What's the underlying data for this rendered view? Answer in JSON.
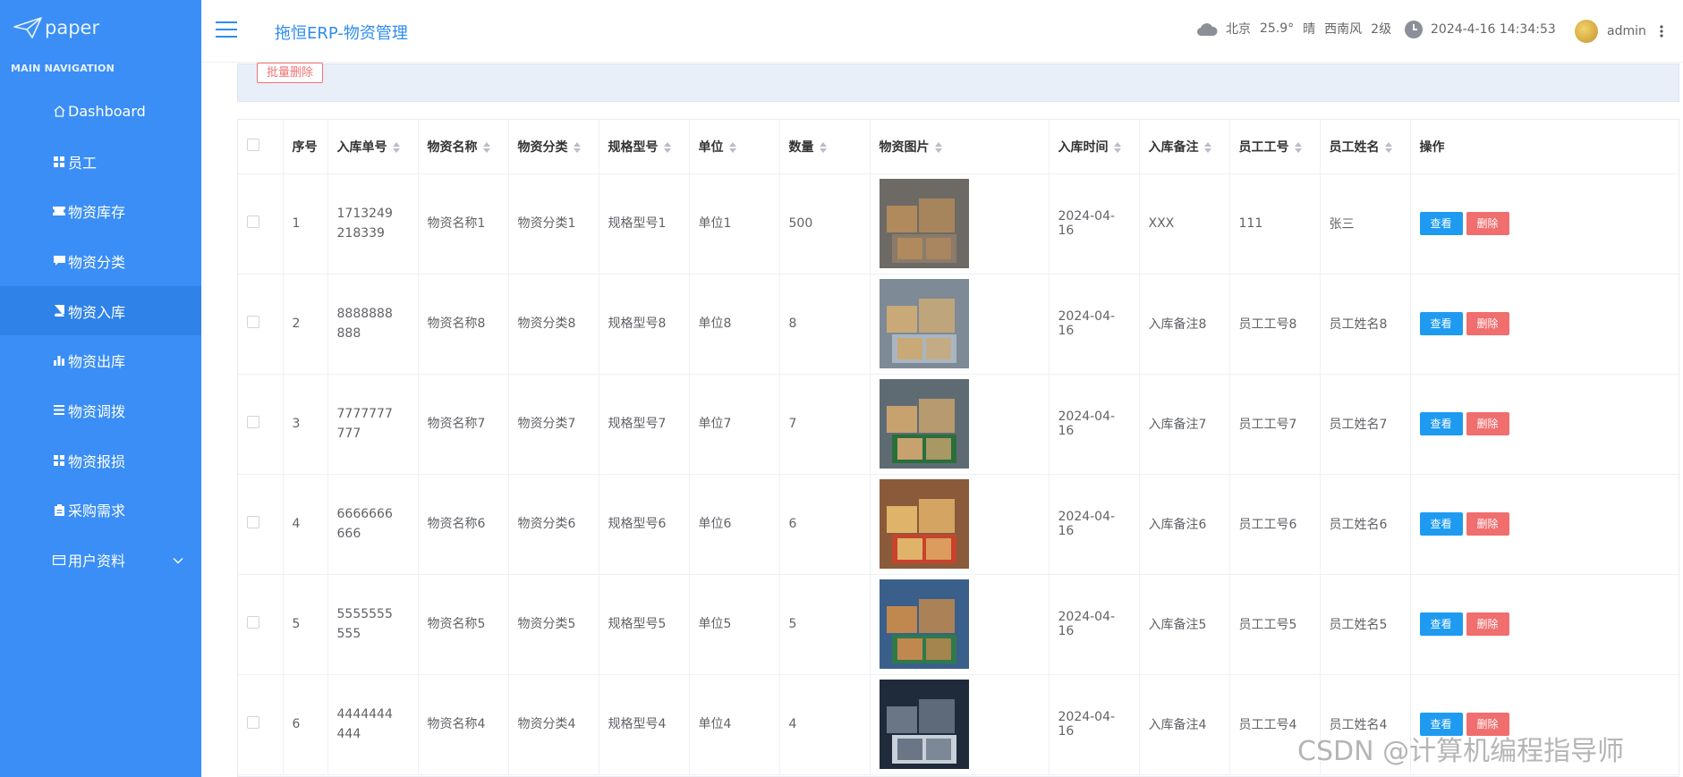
{
  "brand": {
    "name": "paper"
  },
  "sidebar": {
    "heading": "MAIN NAVIGATION",
    "items": [
      {
        "label": "Dashboard",
        "icon": "home-icon"
      },
      {
        "label": "员工",
        "icon": "grid-icon"
      },
      {
        "label": "物资库存",
        "icon": "ticket-icon"
      },
      {
        "label": "物资分类",
        "icon": "comment-icon"
      },
      {
        "label": "物资入库",
        "icon": "book-icon",
        "active": true
      },
      {
        "label": "物资出库",
        "icon": "bar-chart-icon"
      },
      {
        "label": "物资调拨",
        "icon": "list-icon"
      },
      {
        "label": "物资报损",
        "icon": "grid-icon"
      },
      {
        "label": "采购需求",
        "icon": "clipboard-icon"
      },
      {
        "label": "用户资料",
        "icon": "card-icon",
        "expandable": true
      }
    ]
  },
  "header": {
    "title": "拖恒ERP-物资管理",
    "weather": {
      "city": "北京",
      "temp": "25.9°",
      "condition": "晴",
      "wind": "西南风",
      "level": "2级"
    },
    "datetime": "2024-4-16 14:34:53",
    "user": "admin"
  },
  "toolbar": {
    "batch_delete": "批量删除"
  },
  "table": {
    "columns": [
      "序号",
      "入库单号",
      "物资名称",
      "物资分类",
      "规格型号",
      "单位",
      "数量",
      "物资图片",
      "入库时间",
      "入库备注",
      "员工工号",
      "员工姓名",
      "操作"
    ],
    "rows": [
      {
        "no": "1",
        "order": "1713249218339",
        "name": "物资名称1",
        "category": "物资分类1",
        "spec": "规格型号1",
        "unit": "单位1",
        "qty": "500",
        "time": "2024-04-16",
        "note": "XXX",
        "emp_id": "111",
        "emp_name": "张三"
      },
      {
        "no": "2",
        "order": "8888888888",
        "name": "物资名称8",
        "category": "物资分类8",
        "spec": "规格型号8",
        "unit": "单位8",
        "qty": "8",
        "time": "2024-04-16",
        "note": "入库备注8",
        "emp_id": "员工工号8",
        "emp_name": "员工姓名8"
      },
      {
        "no": "3",
        "order": "7777777777",
        "name": "物资名称7",
        "category": "物资分类7",
        "spec": "规格型号7",
        "unit": "单位7",
        "qty": "7",
        "time": "2024-04-16",
        "note": "入库备注7",
        "emp_id": "员工工号7",
        "emp_name": "员工姓名7"
      },
      {
        "no": "4",
        "order": "6666666666",
        "name": "物资名称6",
        "category": "物资分类6",
        "spec": "规格型号6",
        "unit": "单位6",
        "qty": "6",
        "time": "2024-04-16",
        "note": "入库备注6",
        "emp_id": "员工工号6",
        "emp_name": "员工姓名6"
      },
      {
        "no": "5",
        "order": "5555555555",
        "name": "物资名称5",
        "category": "物资分类5",
        "spec": "规格型号5",
        "unit": "单位5",
        "qty": "5",
        "time": "2024-04-16",
        "note": "入库备注5",
        "emp_id": "员工工号5",
        "emp_name": "员工姓名5"
      },
      {
        "no": "6",
        "order": "4444444444",
        "name": "物资名称4",
        "category": "物资分类4",
        "spec": "规格型号4",
        "unit": "单位4",
        "qty": "4",
        "time": "2024-04-16",
        "note": "入库备注4",
        "emp_id": "员工工号4",
        "emp_name": "员工姓名4"
      }
    ],
    "actions": {
      "view": "查看",
      "delete": "删除"
    }
  },
  "watermark": "CSDN @计算机编程指导师",
  "colors": {
    "sidebar": "#3a8ef6",
    "sidebar_active": "#2f82e8",
    "accent": "#2d8cf0",
    "view_button": "#1e9bf0",
    "delete_button": "#f06e6e"
  }
}
